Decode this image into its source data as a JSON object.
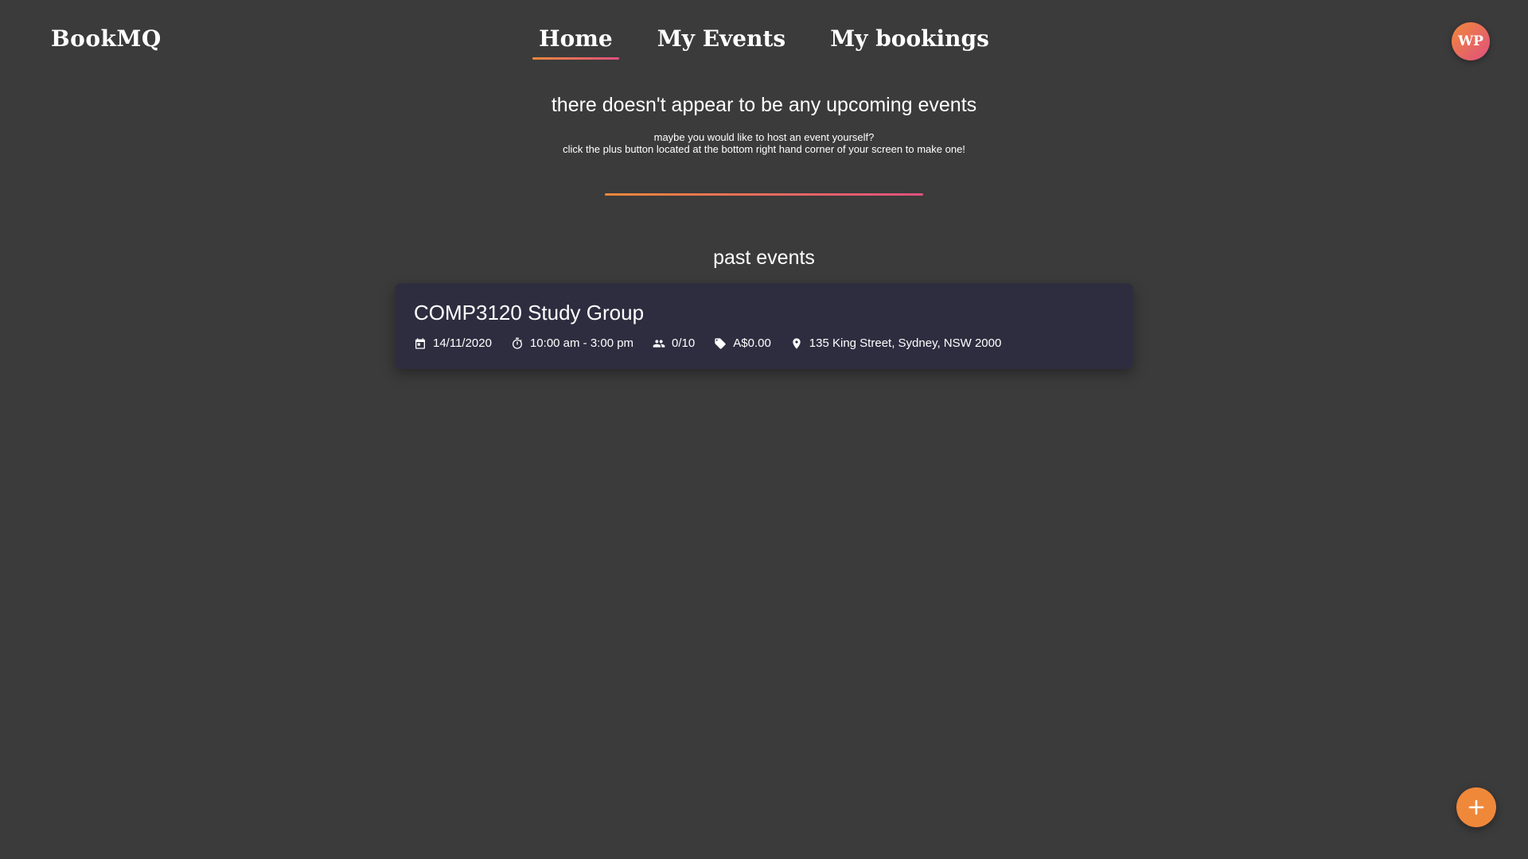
{
  "app": {
    "brand": "BookMQ"
  },
  "nav": {
    "items": [
      {
        "label": "Home",
        "active": true
      },
      {
        "label": "My Events",
        "active": false
      },
      {
        "label": "My bookings",
        "active": false
      }
    ]
  },
  "user": {
    "initials": "WP"
  },
  "upcoming": {
    "empty_title": "there doesn't appear to be any upcoming events",
    "empty_line1": "maybe you would like to host an event yourself?",
    "empty_line2": "click the plus button located at the bottom right hand corner of your screen to make one!"
  },
  "past": {
    "title": "past events",
    "events": [
      {
        "title": "COMP3120 Study Group",
        "date": "14/11/2020",
        "time": "10:00 am - 3:00 pm",
        "attendees": "0/10",
        "price": "A$0.00",
        "location": "135 King Street, Sydney, NSW 2000",
        "icons": [
          "calendar-icon",
          "timer-icon",
          "people-icon",
          "tag-icon",
          "location-pin-icon"
        ]
      }
    ]
  },
  "fab": {
    "icon": "plus-icon"
  },
  "colors": {
    "background": "#3b3b3b",
    "card": "#2e2d40",
    "accent_orange": "#f0883a",
    "accent_pink": "#e0507f",
    "text": "#ffffff"
  }
}
